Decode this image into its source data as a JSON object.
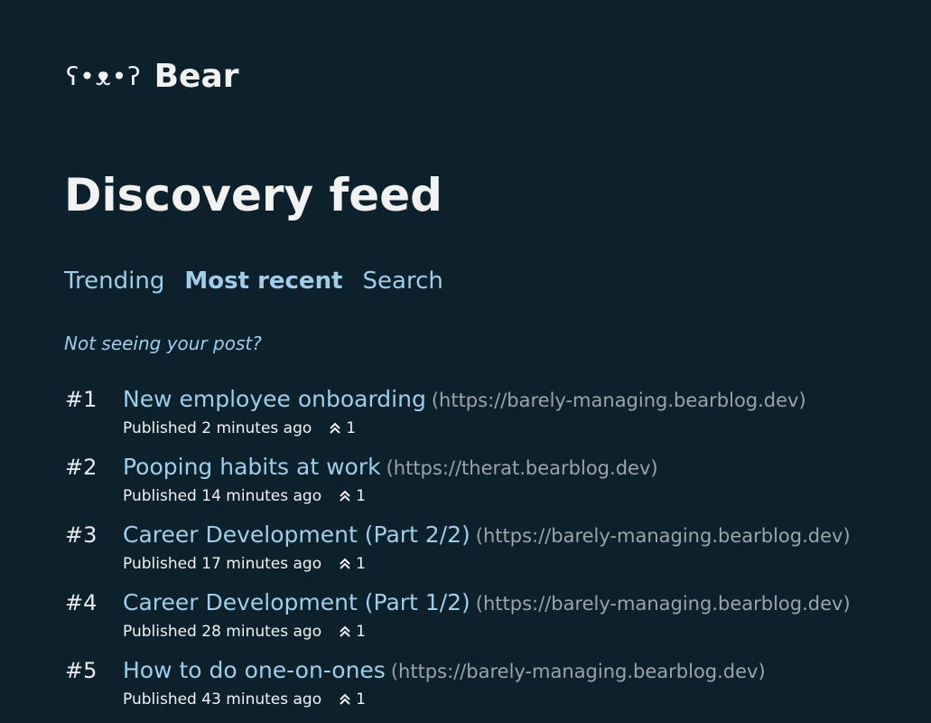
{
  "header": {
    "logo_glyph": "ʕ•ᴥ•ʔ",
    "logo_text": "Bear"
  },
  "page_title": "Discovery feed",
  "tabs": [
    {
      "label": "Trending",
      "active": false
    },
    {
      "label": "Most recent",
      "active": true
    },
    {
      "label": "Search",
      "active": false
    }
  ],
  "notice": "Not seeing your post?",
  "feed": [
    {
      "rank": "#1",
      "title": "New employee onboarding",
      "domain": "(https://barely-managing.bearblog.dev)",
      "published": "Published 2 minutes ago",
      "upvotes": "1"
    },
    {
      "rank": "#2",
      "title": "Pooping habits at work",
      "domain": "(https://therat.bearblog.dev)",
      "published": "Published 14 minutes ago",
      "upvotes": "1"
    },
    {
      "rank": "#3",
      "title": "Career Development (Part 2/2)",
      "domain": "(https://barely-managing.bearblog.dev)",
      "published": "Published 17 minutes ago",
      "upvotes": "1"
    },
    {
      "rank": "#4",
      "title": "Career Development (Part 1/2)",
      "domain": "(https://barely-managing.bearblog.dev)",
      "published": "Published 28 minutes ago",
      "upvotes": "1"
    },
    {
      "rank": "#5",
      "title": "How to do one-on-ones",
      "domain": "(https://barely-managing.bearblog.dev)",
      "published": "Published 43 minutes ago",
      "upvotes": "1"
    }
  ],
  "colors": {
    "background": "#0c212c",
    "link": "#9fcdea",
    "text": "#f2f2f2",
    "muted": "#9aa4a9"
  },
  "icons": {
    "upvote": "double-chevron-up-icon"
  }
}
